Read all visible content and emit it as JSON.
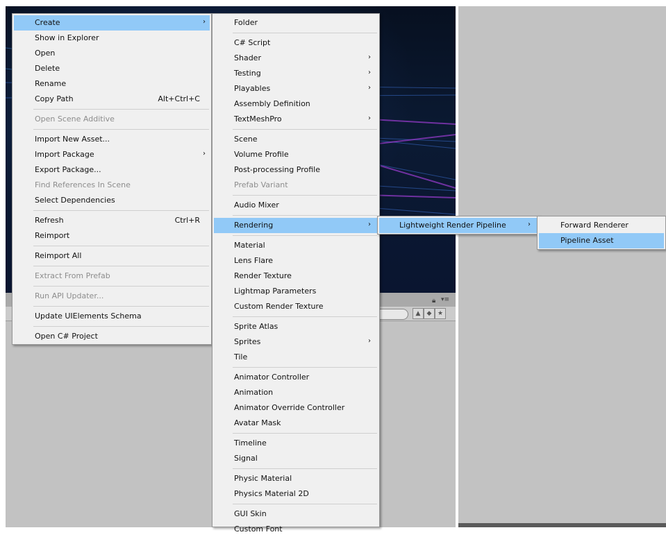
{
  "colors": {
    "menu_bg": "#f0f0f0",
    "highlight": "#91c9f7",
    "disabled_text": "#8d8d8d",
    "panel_gray": "#c2c2c2"
  },
  "context_menu": {
    "items": [
      {
        "label": "Create",
        "has_submenu": true,
        "highlighted": true
      },
      {
        "label": "Show in Explorer"
      },
      {
        "label": "Open"
      },
      {
        "label": "Delete"
      },
      {
        "label": "Rename"
      },
      {
        "label": "Copy Path",
        "shortcut": "Alt+Ctrl+C"
      },
      {
        "label": "Open Scene Additive",
        "disabled": true
      },
      {
        "label": "Import New Asset..."
      },
      {
        "label": "Import Package",
        "has_submenu": true
      },
      {
        "label": "Export Package..."
      },
      {
        "label": "Find References In Scene",
        "disabled": true
      },
      {
        "label": "Select Dependencies"
      },
      {
        "label": "Refresh",
        "shortcut": "Ctrl+R"
      },
      {
        "label": "Reimport"
      },
      {
        "label": "Reimport All"
      },
      {
        "label": "Extract From Prefab",
        "disabled": true
      },
      {
        "label": "Run API Updater...",
        "disabled": true
      },
      {
        "label": "Update UIElements Schema"
      },
      {
        "label": "Open C# Project"
      }
    ]
  },
  "create_menu": {
    "items": [
      {
        "label": "Folder"
      },
      {
        "label": "C# Script"
      },
      {
        "label": "Shader",
        "has_submenu": true
      },
      {
        "label": "Testing",
        "has_submenu": true
      },
      {
        "label": "Playables",
        "has_submenu": true
      },
      {
        "label": "Assembly Definition"
      },
      {
        "label": "TextMeshPro",
        "has_submenu": true
      },
      {
        "label": "Scene"
      },
      {
        "label": "Volume Profile"
      },
      {
        "label": "Post-processing Profile"
      },
      {
        "label": "Prefab Variant",
        "disabled": true
      },
      {
        "label": "Audio Mixer"
      },
      {
        "label": "Rendering",
        "has_submenu": true,
        "highlighted": true
      },
      {
        "label": "Material"
      },
      {
        "label": "Lens Flare"
      },
      {
        "label": "Render Texture"
      },
      {
        "label": "Lightmap Parameters"
      },
      {
        "label": "Custom Render Texture"
      },
      {
        "label": "Sprite Atlas"
      },
      {
        "label": "Sprites",
        "has_submenu": true
      },
      {
        "label": "Tile"
      },
      {
        "label": "Animator Controller"
      },
      {
        "label": "Animation"
      },
      {
        "label": "Animator Override Controller"
      },
      {
        "label": "Avatar Mask"
      },
      {
        "label": "Timeline"
      },
      {
        "label": "Signal"
      },
      {
        "label": "Physic Material"
      },
      {
        "label": "Physics Material 2D"
      },
      {
        "label": "GUI Skin"
      },
      {
        "label": "Custom Font"
      }
    ]
  },
  "rendering_menu": {
    "items": [
      {
        "label": "Lightweight Render Pipeline",
        "has_submenu": true,
        "highlighted": true
      }
    ]
  },
  "lwrp_menu": {
    "items": [
      {
        "label": "Forward Renderer"
      },
      {
        "label": "Pipeline Asset",
        "highlighted": true
      }
    ]
  },
  "icons": {
    "submenu_arrow": "chevron-right-icon",
    "lock": "lock-icon",
    "panel_menu": "panel-menu-icon",
    "filter_type": "filter-by-type-icon",
    "filter_label": "filter-by-label-icon",
    "favorite": "star-icon"
  },
  "glyphs": {
    "arrow": "›",
    "lock": "🔒︎",
    "panel_menu": "▾≡",
    "filter_type": "▲",
    "filter_label": "◆",
    "star": "★"
  }
}
